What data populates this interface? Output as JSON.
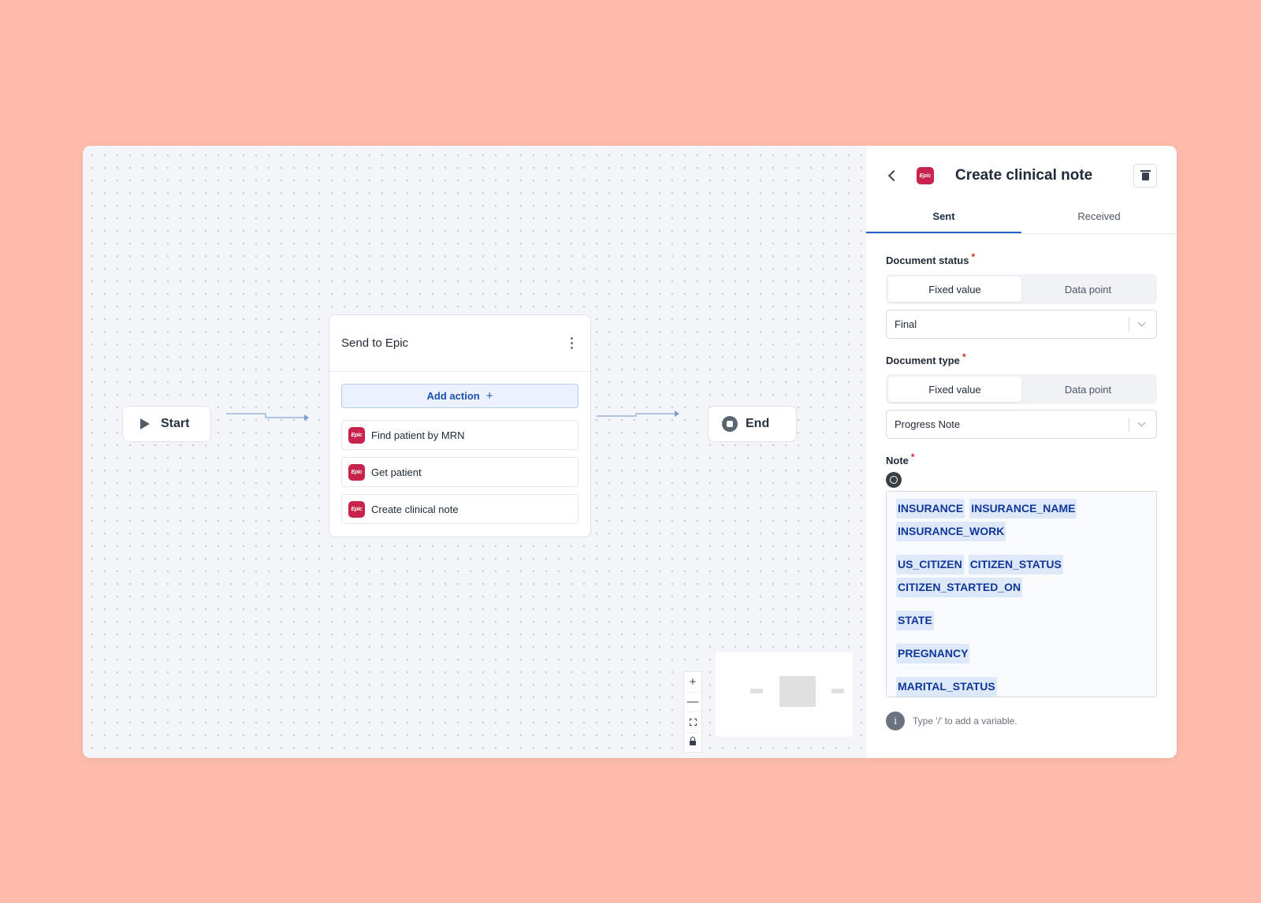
{
  "canvas": {
    "start_label": "Start",
    "end_label": "End",
    "flow_card": {
      "title": "Send to Epic",
      "add_action_label": "Add action",
      "actions": [
        {
          "label": "Find patient by MRN",
          "badge": "Epic"
        },
        {
          "label": "Get patient",
          "badge": "Epic"
        },
        {
          "label": "Create clinical note",
          "badge": "Epic"
        }
      ]
    },
    "zoom_controls": {
      "zoom_in": "+",
      "zoom_out": "—"
    }
  },
  "panel": {
    "badge": "Epic",
    "title": "Create clinical note",
    "tabs": [
      {
        "label": "Sent",
        "active": true
      },
      {
        "label": "Received",
        "active": false
      }
    ],
    "document_status": {
      "label": "Document status",
      "required_mark": "*",
      "options": [
        "Fixed value",
        "Data point"
      ],
      "selected_option": "Fixed value",
      "value": "Final"
    },
    "document_type": {
      "label": "Document type",
      "required_mark": "*",
      "options": [
        "Fixed value",
        "Data point"
      ],
      "selected_option": "Fixed value",
      "value": "Progress Note"
    },
    "note": {
      "label": "Note",
      "required_mark": "*",
      "groups": [
        [
          "INSURANCE",
          "INSURANCE_NAME",
          "INSURANCE_WORK"
        ],
        [
          "US_CITIZEN",
          "CITIZEN_STATUS",
          "CITIZEN_STARTED_ON"
        ],
        [
          "STATE"
        ],
        [
          "PREGNANCY"
        ],
        [
          "MARITAL_STATUS"
        ]
      ]
    },
    "hint": {
      "icon_text": "i",
      "text": "Type '/' to add a variable."
    }
  },
  "colors": {
    "background": "#fdbcab",
    "epic_brand": "#c8234b",
    "accent_blue": "#2563c9",
    "chip_text": "#12379a",
    "chip_bg": "#dde9f8"
  },
  "icons": [
    "play-icon",
    "stop-icon",
    "kebab-icon",
    "plus-icon",
    "back-icon",
    "trash-icon",
    "chevron-down-icon",
    "ai-assist-icon",
    "info-icon",
    "fit-view-icon",
    "lock-icon"
  ]
}
